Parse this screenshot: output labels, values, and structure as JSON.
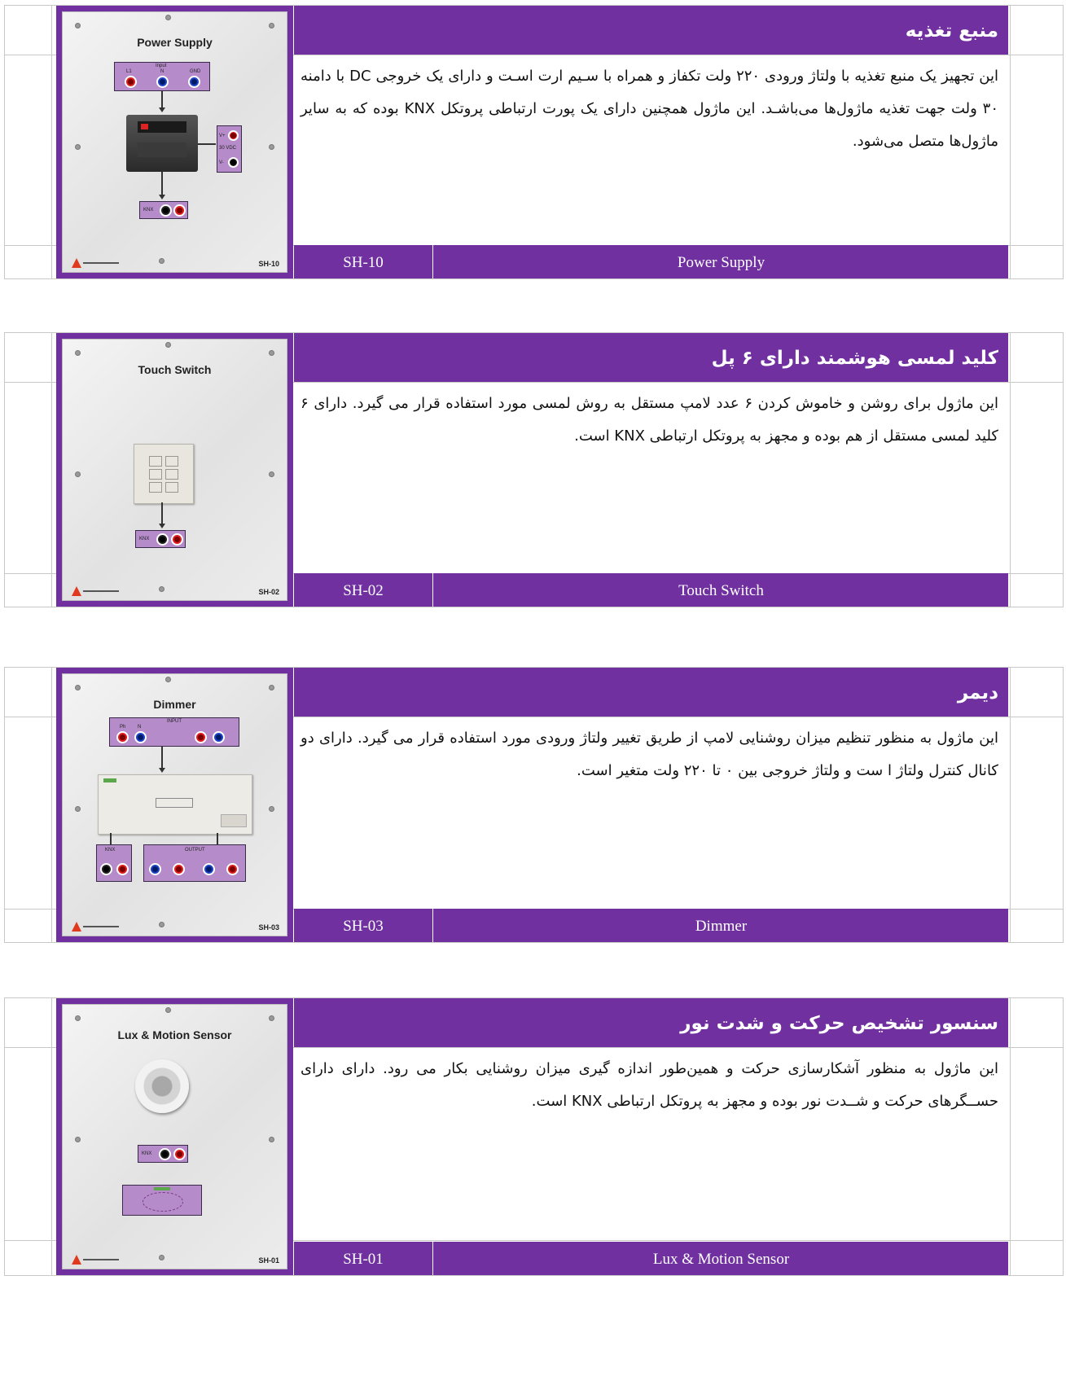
{
  "modules": [
    {
      "board_title": "Power Supply",
      "board_code": "SH-10",
      "board_labels": {
        "input": "Input",
        "l1": "L1",
        "n": "N",
        "gnd": "GND",
        "vplus": "V+",
        "vminus": "V-",
        "vdc": "30 VDC",
        "knx": "KNX"
      },
      "title": "منبع تغذیه",
      "description": "این تجهیز یک منبع تغذیه با ولتاژ ورودی ۲۲۰ ولت تکفاز و همراه با سـیم ارت اسـت و دارای یک خروجی DC با دامنه ۳۰ ولت جهت تغذیه ماژول‌ها می‌باشـد. این ماژول همچنین دارای یک پورت ارتباطی پروتکل KNX بوده که به سایر ماژول‌ها متصل می‌شود.",
      "code": "SH-10",
      "name": "Power Supply"
    },
    {
      "board_title": "Touch Switch",
      "board_code": "SH-02",
      "board_labels": {
        "knx": "KNX"
      },
      "title": "کلید لمسی هوشمند دارای ۶ پل",
      "description": "این ماژول برای روشن و خاموش کردن ۶ عدد لامپ مستقل به روش لمسی مورد استفاده قرار می گیرد. دارای ۶ کلید لمسی مستقل از هم بوده و مجهز به پروتکل ارتباطی KNX است.",
      "code": "SH-02",
      "name": "Touch Switch"
    },
    {
      "board_title": "Dimmer",
      "board_code": "SH-03",
      "board_labels": {
        "input": "INPUT",
        "output": "OUTPUT",
        "knx": "KNX",
        "ph": "Ph",
        "n": "N"
      },
      "title": "دیمر",
      "description": "این ماژول به منظور تنظیم میزان روشنایی لامپ از طریق تغییر ولتاژ ورودی مورد استفاده قرار می گیرد. دارای دو کانال کنترل ولتاژ ا ست و ولتاژ خروجی بین ۰ تا ۲۲۰ ولت متغیر است.",
      "code": "SH-03",
      "name": "Dimmer"
    },
    {
      "board_title": "Lux & Motion Sensor",
      "board_code": "SH-01",
      "board_labels": {
        "knx": "KNX"
      },
      "title": "سنسور تشخیص حرکت و شدت نور",
      "description": "این ماژول به منظور آشکارسازی حرکت و همین‌طور اندازه گیری میزان روشنایی بکار می رود. دارای دارای حســگرهای حرکت و شــدت نور بوده و مجهز به پروتکل ارتباطی KNX است.",
      "code": "SH-01",
      "name": "Lux & Motion Sensor"
    }
  ]
}
